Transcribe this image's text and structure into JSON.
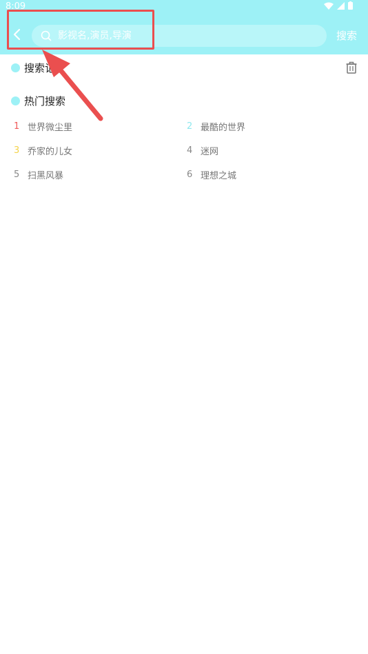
{
  "status_bar": {
    "time": "8:09"
  },
  "header": {
    "search_placeholder": "影视名,演员,导演",
    "search_button": "搜索"
  },
  "history": {
    "title": "搜索记录"
  },
  "hot": {
    "title": "热门搜索",
    "items": [
      {
        "rank": "1",
        "name": "世界微尘里",
        "rank_color": "#f05a5a"
      },
      {
        "rank": "2",
        "name": "最酷的世界",
        "rank_color": "#8fe8ee"
      },
      {
        "rank": "3",
        "name": "乔家的儿女",
        "rank_color": "#f4d34a"
      },
      {
        "rank": "4",
        "name": "迷网",
        "rank_color": "#888888"
      },
      {
        "rank": "5",
        "name": "扫黑风暴",
        "rank_color": "#888888"
      },
      {
        "rank": "6",
        "name": "理想之城",
        "rank_color": "#888888"
      }
    ]
  },
  "colors": {
    "accent": "#9df1f6",
    "annotation": "#ea4f4f"
  }
}
